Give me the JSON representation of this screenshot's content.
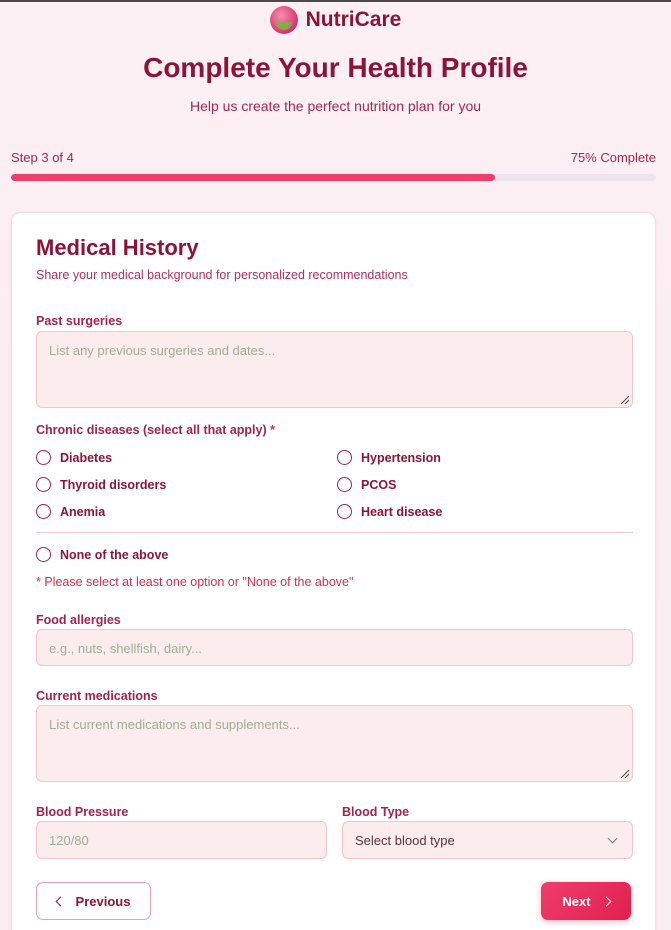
{
  "brand": {
    "name": "NutriCare"
  },
  "header": {
    "title": "Complete Your Health Profile",
    "subtitle": "Help us create the perfect nutrition plan for you"
  },
  "progress": {
    "step_label": "Step 3 of 4",
    "percent_label": "75% Complete",
    "percent": 75
  },
  "section": {
    "title": "Medical History",
    "subtitle": "Share your medical background for personalized recommendations"
  },
  "fields": {
    "past_surgeries": {
      "label": "Past surgeries",
      "placeholder": "List any previous surgeries and dates..."
    },
    "chronic": {
      "label": "Chronic diseases (select all that apply)",
      "required_mark": "*",
      "options": [
        "Diabetes",
        "Hypertension",
        "Thyroid disorders",
        "PCOS",
        "Anemia",
        "Heart disease"
      ],
      "none_option": "None of the above",
      "error": "* Please select at least one option or \"None of the above\""
    },
    "food_allergies": {
      "label": "Food allergies",
      "placeholder": "e.g., nuts, shellfish, dairy..."
    },
    "medications": {
      "label": "Current medications",
      "placeholder": "List current medications and supplements..."
    },
    "blood_pressure": {
      "label": "Blood Pressure",
      "placeholder": "120/80"
    },
    "blood_type": {
      "label": "Blood Type",
      "selected": "Select blood type"
    }
  },
  "buttons": {
    "previous": "Previous",
    "next": "Next"
  },
  "colors": {
    "accent": "#ec3f6a",
    "brand": "#8a1538"
  }
}
